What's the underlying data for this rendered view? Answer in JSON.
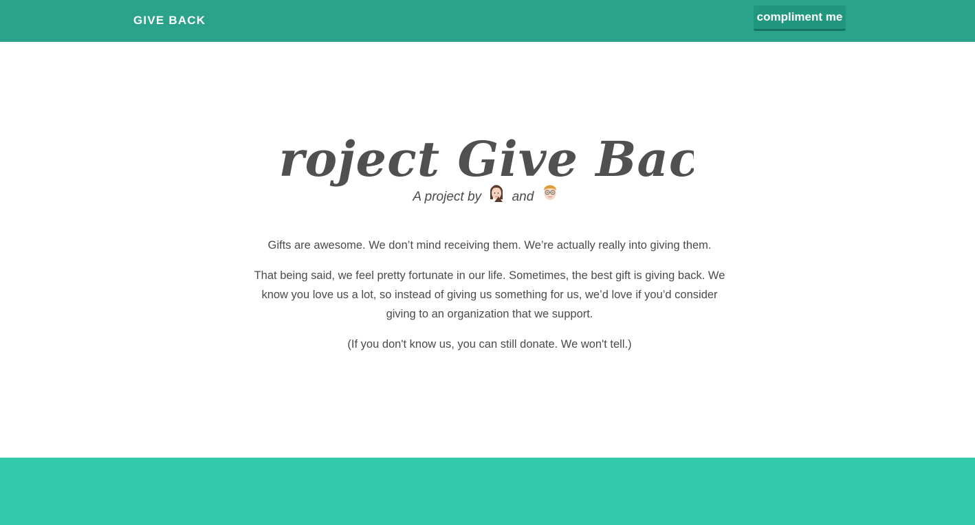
{
  "navbar": {
    "brand": "GIVE BACK",
    "compliment_button": "compliment me",
    "background_color": "#2aa38a"
  },
  "hero": {
    "title": "Project Give Back",
    "byline_prefix": "A project by",
    "byline_and": "and",
    "avatars": [
      "woman-avatar-icon",
      "man-with-glasses-avatar-icon"
    ]
  },
  "content": {
    "paragraph_1": "Gifts are awesome. We don’t mind receiving them. We’re actually really into giving them.",
    "paragraph_2": "That being said, we feel pretty fortunate in our life. Sometimes, the best gift is giving back. We know you love us a lot, so instead of giving us something for us, we’d love if you’d consider giving to an organization that we support.",
    "paragraph_3": "(If you don't know us, you can still donate. We won't tell.)"
  },
  "footer": {
    "background_color": "#32c9ad"
  }
}
